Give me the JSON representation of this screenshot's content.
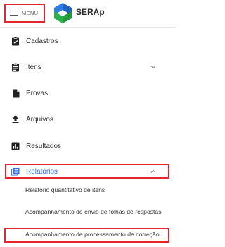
{
  "header": {
    "menu_label": "MENU",
    "brand": "SERAp"
  },
  "colors": {
    "highlight_border": "#e3262e",
    "active_text": "#3a6fd8",
    "logo_blue": "#1e5fbf",
    "logo_green": "#29b24a"
  },
  "nav": {
    "cadastros": {
      "label": "Cadastros",
      "icon": "clipboard-check-icon"
    },
    "itens": {
      "label": "Itens",
      "icon": "clipboard-list-icon",
      "expanded": false
    },
    "provas": {
      "label": "Provas",
      "icon": "document-icon"
    },
    "arquivos": {
      "label": "Arquivos",
      "icon": "upload-icon"
    },
    "resultados": {
      "label": "Resultados",
      "icon": "bar-chart-icon"
    },
    "relatorios": {
      "label": "Relatórios",
      "icon": "report-list-icon",
      "expanded": true,
      "items": [
        "Relatório quantitativo de itens",
        "Acompanhamento de envio de folhas de respostas",
        "Acompanhamento de processamento de correção"
      ]
    }
  }
}
